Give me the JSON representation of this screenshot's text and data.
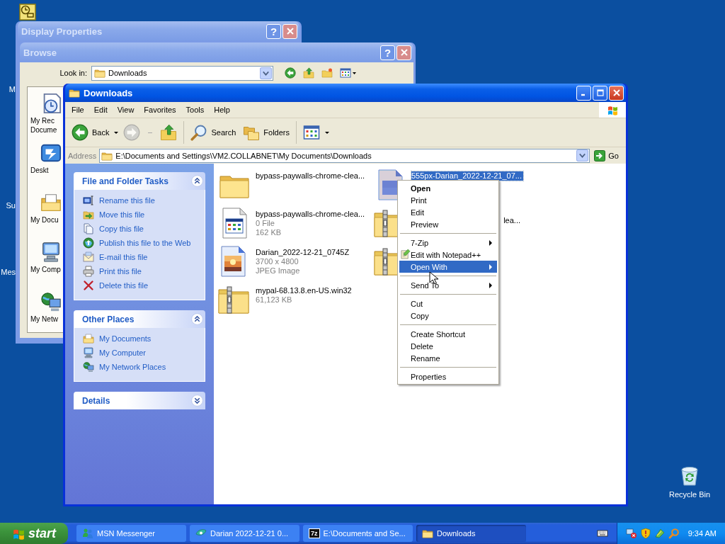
{
  "desktop": {
    "label_fragments": [
      "M",
      "Su",
      "Mes"
    ],
    "recycle_bin": {
      "label": "Recycle Bin"
    }
  },
  "display_properties": {
    "title": "Display Properties",
    "active": false,
    "help": "?"
  },
  "browse": {
    "title": "Browse",
    "active": false,
    "help": "?",
    "look_in_label": "Look in:",
    "look_in_value": "Downloads",
    "places": [
      {
        "kind": "recent",
        "lines": [
          "My Rec",
          "Docume"
        ]
      },
      {
        "kind": "desktop",
        "lines": [
          "Deskt"
        ]
      },
      {
        "kind": "documents",
        "lines": [
          "My Docu"
        ]
      },
      {
        "kind": "computer",
        "lines": [
          "My Comp"
        ]
      },
      {
        "kind": "network",
        "lines": [
          "My Netw"
        ]
      }
    ]
  },
  "explorer": {
    "title": "Downloads",
    "active": true,
    "menu": [
      "File",
      "Edit",
      "View",
      "Favorites",
      "Tools",
      "Help"
    ],
    "toolbar": [
      {
        "kind": "back",
        "label": "Back",
        "disabled": false
      },
      {
        "kind": "forward",
        "disabled": true
      },
      {
        "kind": "up",
        "disabled": false
      },
      {
        "kind": "search",
        "label": "Search",
        "disabled": false
      },
      {
        "kind": "folders",
        "label": "Folders",
        "disabled": false
      },
      {
        "kind": "views",
        "disabled": false
      }
    ],
    "address": {
      "label": "Address",
      "value": "E:\\Documents and Settings\\VM2.COLLABNET\\My Documents\\Downloads",
      "go": "Go"
    },
    "panels": [
      {
        "title": "File and Folder Tasks",
        "expanded": true,
        "items": [
          {
            "kind": "rename",
            "label": "Rename this file"
          },
          {
            "kind": "move",
            "label": "Move this file"
          },
          {
            "kind": "copy",
            "label": "Copy this file"
          },
          {
            "kind": "publish",
            "label": "Publish this file to the Web"
          },
          {
            "kind": "email",
            "label": "E-mail this file"
          },
          {
            "kind": "print",
            "label": "Print this file"
          },
          {
            "kind": "delete",
            "label": "Delete this file"
          }
        ]
      },
      {
        "title": "Other Places",
        "expanded": true,
        "items": [
          {
            "kind": "documents",
            "label": "My Documents"
          },
          {
            "kind": "computer",
            "label": "My Computer"
          },
          {
            "kind": "network",
            "label": "My Network Places"
          }
        ]
      },
      {
        "title": "Details",
        "expanded": false
      }
    ],
    "files": [
      {
        "kind": "folder",
        "name": "bypass-paywalls-chrome-clea...",
        "selected": false
      },
      {
        "kind": "image",
        "name": "555px-Darian_2022-12-21_07...",
        "selected": true
      },
      {
        "kind": "app",
        "name": "bypass-paywalls-chrome-clea...",
        "details": [
          "0 File",
          "162 KB"
        ],
        "selected": false
      },
      {
        "kind": "zip",
        "name_tail": "lea...",
        "selected": false
      },
      {
        "kind": "photo",
        "name": "Darian_2022-12-21_0745Z",
        "details": [
          "3700 x 4800",
          "JPEG Image"
        ],
        "selected": false
      },
      {
        "kind": "zip",
        "selected": false
      },
      {
        "kind": "zip",
        "name": "mypal-68.13.8.en-US.win32",
        "details": [
          "61,123 KB"
        ],
        "selected": false
      }
    ]
  },
  "context_menu": {
    "items": [
      {
        "kind": "default",
        "label": "Open",
        "selected": false
      },
      {
        "kind": "item",
        "label": "Print",
        "selected": false
      },
      {
        "kind": "item",
        "label": "Edit",
        "selected": false
      },
      {
        "kind": "item",
        "label": "Preview",
        "selected": false
      },
      {
        "kind": "separator"
      },
      {
        "kind": "submenu",
        "label": "7-Zip",
        "selected": false
      },
      {
        "kind": "icon",
        "label": "Edit with Notepad++",
        "selected": false
      },
      {
        "kind": "submenu",
        "label": "Open With",
        "selected": true
      },
      {
        "kind": "separator"
      },
      {
        "kind": "submenu",
        "label": "Send To",
        "selected": false
      },
      {
        "kind": "separator"
      },
      {
        "kind": "item",
        "label": "Cut",
        "selected": false
      },
      {
        "kind": "item",
        "label": "Copy",
        "selected": false
      },
      {
        "kind": "separator"
      },
      {
        "kind": "item",
        "label": "Create Shortcut",
        "selected": false
      },
      {
        "kind": "item",
        "label": "Delete",
        "selected": false
      },
      {
        "kind": "item",
        "label": "Rename",
        "selected": false
      },
      {
        "kind": "separator"
      },
      {
        "kind": "item",
        "label": "Properties",
        "selected": false
      }
    ]
  },
  "taskbar": {
    "start": "start",
    "tasks": [
      {
        "kind": "messenger",
        "label": "MSN Messenger",
        "selected": false
      },
      {
        "kind": "viewer",
        "label": "Darian 2022-12-21 0...",
        "selected": false
      },
      {
        "kind": "archiver",
        "icon_text": "7z",
        "label": "E:\\Documents and Se...",
        "selected": false
      },
      {
        "kind": "folder",
        "label": "Downloads",
        "selected": true
      }
    ],
    "clock": "9:34 AM"
  }
}
